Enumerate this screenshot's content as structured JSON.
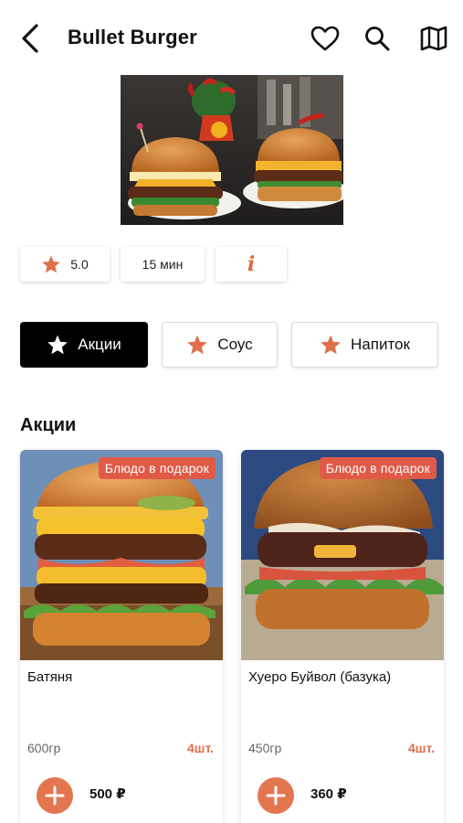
{
  "header": {
    "title": "Bullet Burger",
    "icons": [
      "back-arrow-icon",
      "heart-icon",
      "search-icon",
      "map-icon"
    ]
  },
  "info": {
    "rating": "5.0",
    "time": "15 мин",
    "info_glyph": "i"
  },
  "tabs": [
    {
      "label": "Акции",
      "active": true,
      "icon": "star-icon"
    },
    {
      "label": "Соус",
      "active": false,
      "icon": "star-icon"
    },
    {
      "label": "Напиток",
      "active": false,
      "icon": "star-icon"
    }
  ],
  "section": {
    "title": "Акции"
  },
  "products": [
    {
      "badge": "Блюдо в подарок",
      "name": "Батяня",
      "weight": "600гр",
      "qty": "4шт.",
      "price": "500 ₽"
    },
    {
      "badge": "Блюдо в подарок",
      "name": "Хуеро Буйвол (базука)",
      "weight": "450гр",
      "qty": "4шт.",
      "price": "360 ₽"
    }
  ],
  "colors": {
    "accent": "#e3764f",
    "badge": "#e05a47",
    "active_tab": "#000000"
  }
}
